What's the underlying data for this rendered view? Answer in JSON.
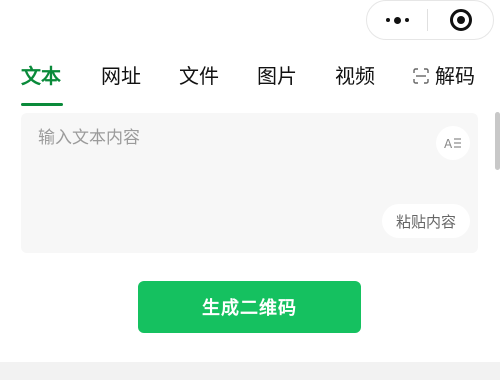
{
  "tabs": [
    {
      "label": "文本"
    },
    {
      "label": "网址"
    },
    {
      "label": "文件"
    },
    {
      "label": "图片"
    },
    {
      "label": "视频"
    },
    {
      "label": "解码"
    }
  ],
  "input": {
    "placeholder": "输入文本内容",
    "font_button": "A☰",
    "paste_label": "粘贴内容"
  },
  "generate_button": "生成二维码",
  "colors": {
    "accent": "#0a8a3a",
    "button": "#15c160"
  },
  "icons": {
    "capsule_more": "more-dots-icon",
    "capsule_close": "target-icon",
    "scan": "scan-icon"
  }
}
